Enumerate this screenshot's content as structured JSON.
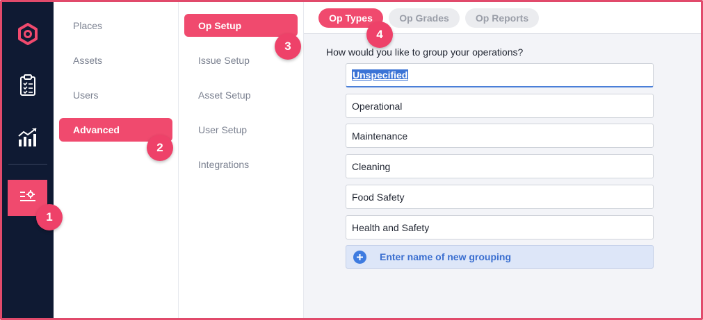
{
  "rail": {
    "icons": [
      "hexagon-logo-icon",
      "clipboard-checklist-icon",
      "analytics-chart-icon",
      "settings-sliders-icon"
    ],
    "active_color": "#f04a6e",
    "bg_color": "#0f1a33"
  },
  "nav1": {
    "items": [
      "Places",
      "Assets",
      "Users"
    ],
    "active": "Advanced"
  },
  "nav2": {
    "active": "Op Setup",
    "items": [
      "Issue Setup",
      "Asset Setup",
      "User Setup",
      "Integrations"
    ]
  },
  "tabs": {
    "active": "Op Types",
    "items": [
      "Op Grades",
      "Op Reports"
    ]
  },
  "badges": [
    "1",
    "2",
    "3",
    "4"
  ],
  "main": {
    "question": "How would you like to group your operations?",
    "groups": [
      "Unspecified",
      "Operational",
      "Maintenance",
      "Cleaning",
      "Food Safety",
      "Health and Safety"
    ],
    "new_group_placeholder": "Enter name of new grouping"
  }
}
